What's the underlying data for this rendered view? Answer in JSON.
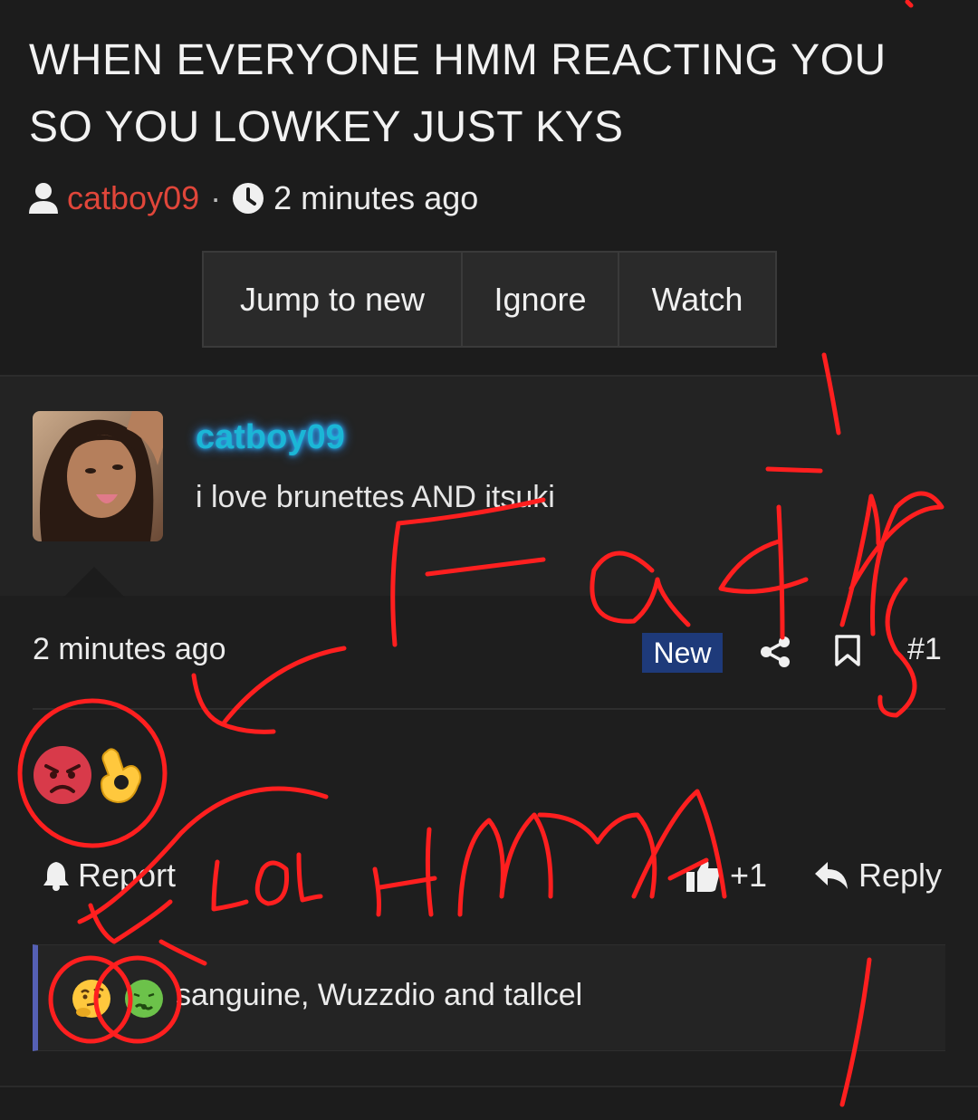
{
  "thread": {
    "title": "WHEN EVERYONE HMM REACTING YOU SO YOU LOWKEY JUST KYS",
    "author": "catboy09",
    "separator": "·",
    "posted": "2 minutes ago"
  },
  "actions": {
    "jump_to_new": "Jump to new",
    "ignore": "Ignore",
    "watch": "Watch"
  },
  "post": {
    "username": "catboy09",
    "signature": "i love brunettes AND itsuki",
    "time": "2 minutes ago",
    "new_badge": "New",
    "number": "#1",
    "reactions": [
      "angry-face",
      "ok-hand"
    ],
    "report_label": "Report",
    "like_count": "+1",
    "reply_label": "Reply",
    "reactors": "sanguine, Wuzzdio and tallcel",
    "reactor_icons": [
      "thinking-face",
      "nauseated-face"
    ]
  },
  "colors": {
    "background": "#1c1c1c",
    "author": "#e0463a",
    "username_glow": "#1bb6d6",
    "new_badge": "#1e3a7a",
    "reaction_bar_accent": "#5560b4",
    "annotation": "#ff1f1f"
  }
}
